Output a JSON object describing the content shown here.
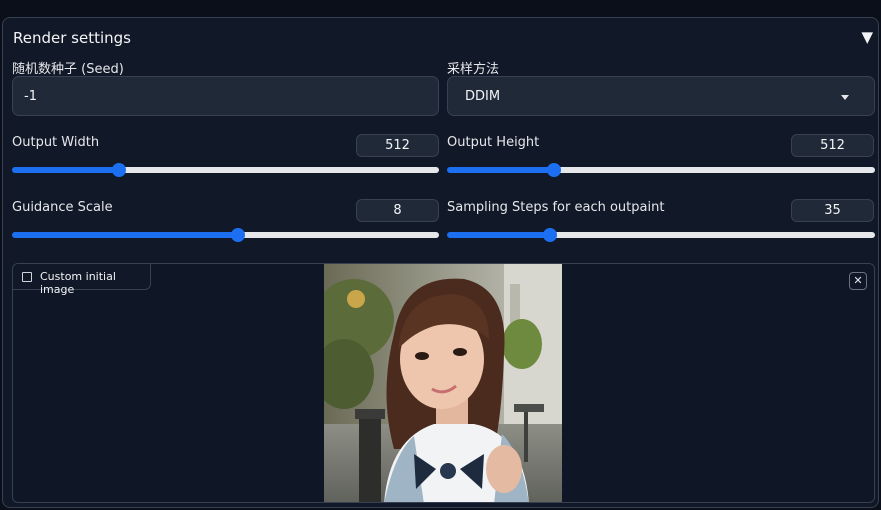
{
  "panel": {
    "title": "Render settings",
    "collapse_icon": "▼"
  },
  "seed": {
    "label": "随机数种子 (Seed)",
    "value": "-1"
  },
  "sampler": {
    "label": "采样方法",
    "value": "DDIM"
  },
  "sliders": [
    {
      "label": "Output Width",
      "value": "512",
      "fraction": 0.25
    },
    {
      "label": "Output Height",
      "value": "512",
      "fraction": 0.25
    },
    {
      "label": "Guidance Scale",
      "value": "8",
      "fraction": 0.53
    },
    {
      "label": "Sampling Steps for each outpaint",
      "value": "35",
      "fraction": 0.24
    }
  ],
  "image": {
    "label": "Custom initial image",
    "tag_icon": "image-icon",
    "close_icon": "close-icon",
    "close_glyph": "✕"
  },
  "colors": {
    "accent": "#1d6ff2",
    "track_empty": "#e5e7eb",
    "background": "#0b0f19",
    "panel": "#111827"
  }
}
